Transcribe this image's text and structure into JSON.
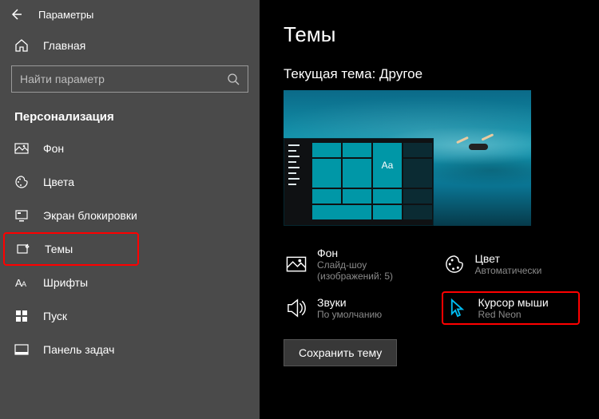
{
  "app_title": "Параметры",
  "home_label": "Главная",
  "search_placeholder": "Найти параметр",
  "section_title": "Персонализация",
  "nav": [
    {
      "label": "Фон"
    },
    {
      "label": "Цвета"
    },
    {
      "label": "Экран блокировки"
    },
    {
      "label": "Темы"
    },
    {
      "label": "Шрифты"
    },
    {
      "label": "Пуск"
    },
    {
      "label": "Панель задач"
    }
  ],
  "page_title": "Темы",
  "current_theme_prefix": "Текущая тема:",
  "current_theme_name": "Другое",
  "preview_tile_text": "Aa",
  "settings": {
    "background": {
      "title": "Фон",
      "sub": "Слайд-шоу (изображений: 5)"
    },
    "color": {
      "title": "Цвет",
      "sub": "Автоматически"
    },
    "sounds": {
      "title": "Звуки",
      "sub": "По умолчанию"
    },
    "cursor": {
      "title": "Курсор мыши",
      "sub": "Red Neon"
    }
  },
  "save_button": "Сохранить тему"
}
